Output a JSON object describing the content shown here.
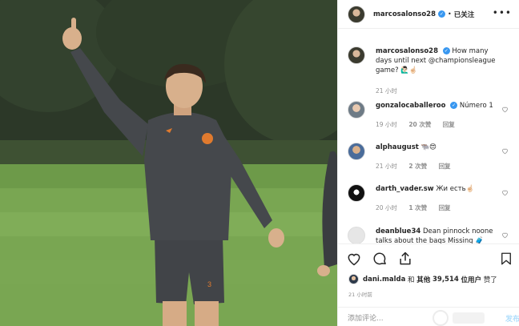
{
  "header": {
    "username": "marcosalonso28",
    "separator": "•",
    "follow_status": "已关注",
    "more": "•••"
  },
  "caption": {
    "username": "marcosalonso28",
    "text": "How many days until next @championsleague game? 🙋🏻‍♂️☝🏻",
    "time": "21 小时"
  },
  "comments": [
    {
      "username": "gonzalocaballeroo",
      "text": "Número 1",
      "time": "19 小时",
      "likes": "20 次赞",
      "reply": "回复"
    },
    {
      "username": "alphaugust",
      "text": "🐃😍",
      "time": "21 小时",
      "likes": "2 次赞",
      "reply": "回复"
    },
    {
      "username": "darth_vader.sw",
      "text": "Жи есть☝🏻",
      "time": "20 小时",
      "likes": "1 次赞",
      "reply": "回复"
    },
    {
      "username": "deanblue34",
      "text": "Dean pinnock noone talks about the bags Missing 🧳",
      "time": "",
      "likes": "",
      "reply": ""
    }
  ],
  "likes_line": {
    "user": "dani.malda",
    "and": "和",
    "others_label": "其他",
    "count": "39,514",
    "suffix": "位用户",
    "action": "赞了"
  },
  "post_time": "21 小时前",
  "add_comment": {
    "placeholder": "添加评论...",
    "post_label": "发布"
  },
  "icons": [
    "heart-icon",
    "comment-icon",
    "share-icon",
    "bookmark-icon",
    "verified-badge-icon",
    "more-options-icon"
  ],
  "colors": {
    "verified": "#3897f0",
    "text": "#262626",
    "muted": "#8e8e8e",
    "post_button": "#b2dffc"
  }
}
